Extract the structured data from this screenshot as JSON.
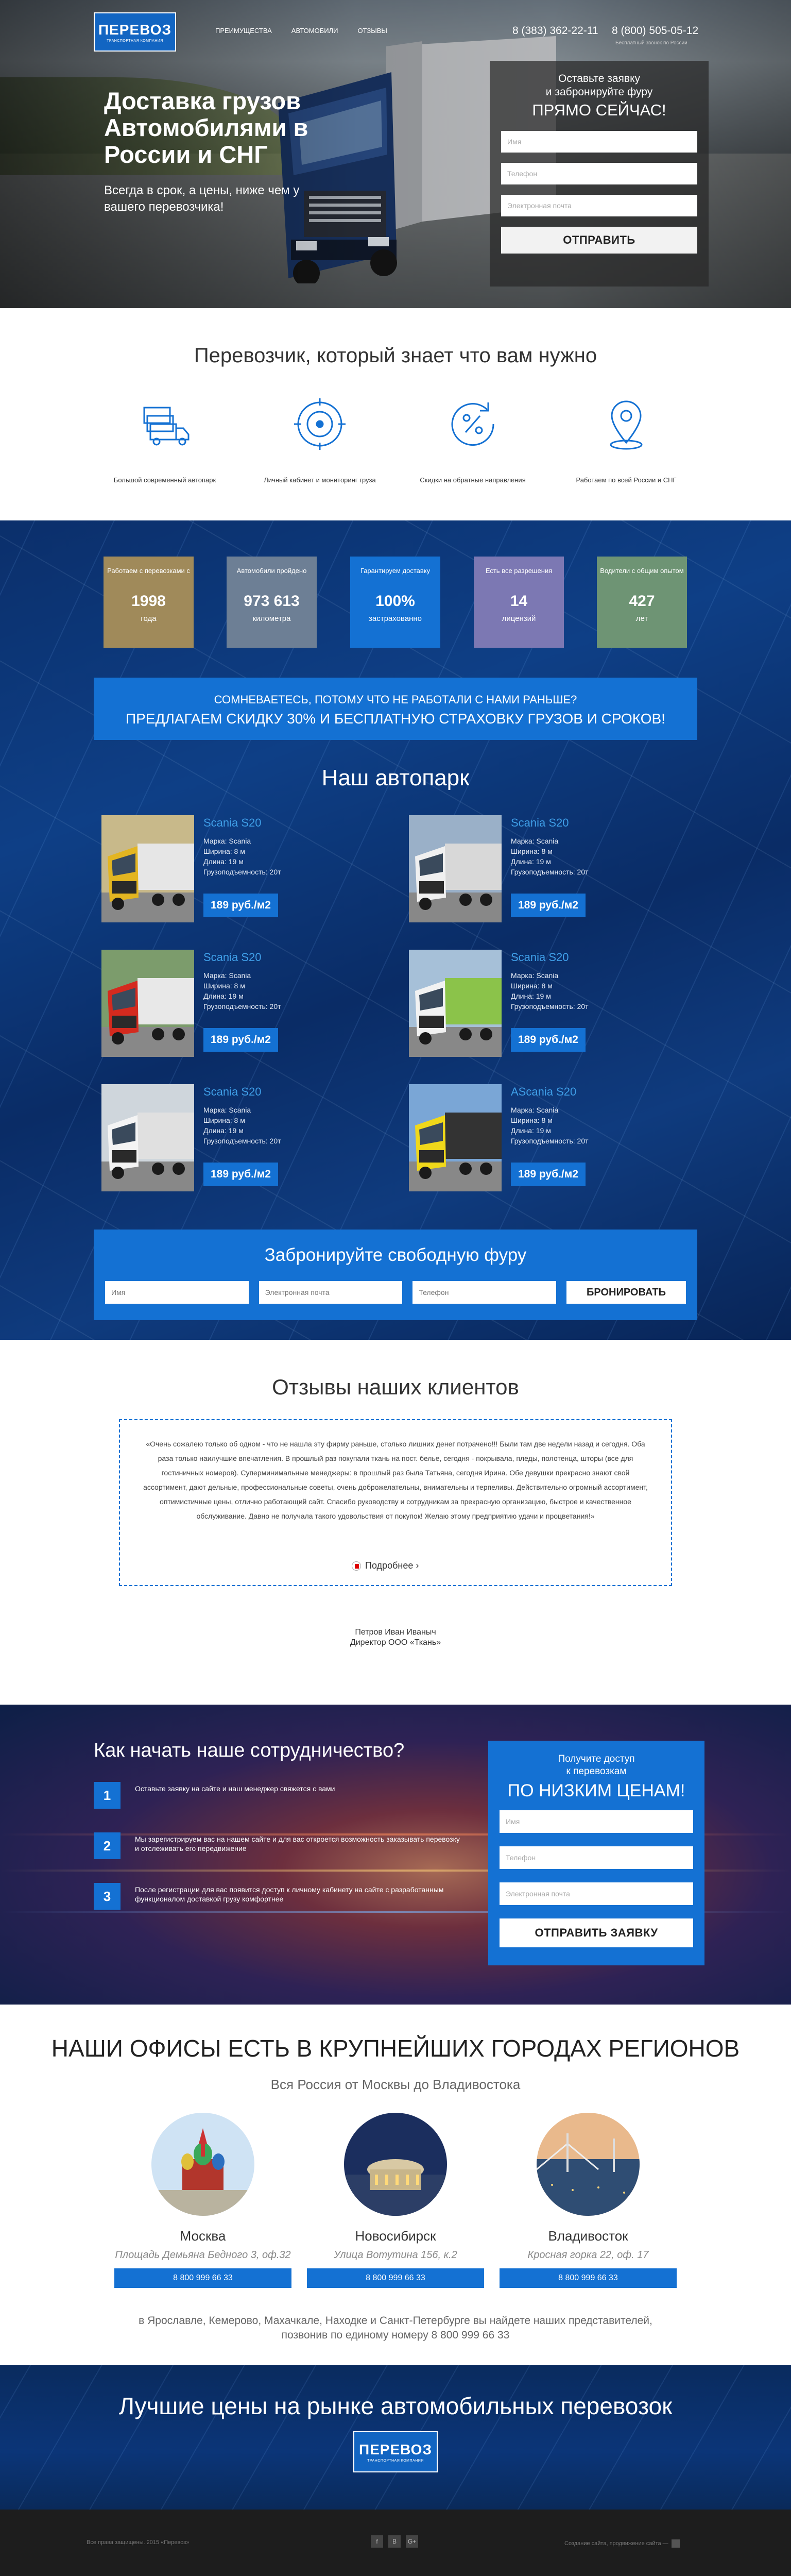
{
  "header": {
    "logo_main": "ПЕРЕВОЗ",
    "logo_sub": "ТРАНСПОРТНАЯ КОМПАНИЯ",
    "nav": [
      "ПРЕИМУЩЕСТВА",
      "АВТОМОБИЛИ",
      "ОТЗЫВЫ"
    ],
    "phone1": "8 (383) 362-22-11",
    "phone2": "8 (800) 505-05-12",
    "phone_note": "Бесплатный звонок по России"
  },
  "hero": {
    "title": "Доставка грузов Автомобилями в России и СНГ",
    "subtitle": "Всегда в срок, а цены, ниже чем у вашего перевозчика!",
    "form_line1": "Оставьте заявку",
    "form_line2": "и забронируйте фуру",
    "form_line3": "ПРЯМО СЕЙЧАС!",
    "ph_name": "Имя",
    "ph_phone": "Телефон",
    "ph_email": "Электронная почта",
    "submit": "ОТПРАВИТЬ"
  },
  "features": {
    "title": "Перевозчик, который знает что вам нужно",
    "items": [
      {
        "label": "Большой современный автопарк",
        "icon": "trucks-icon"
      },
      {
        "label": "Личный кабинет и мониторинг груза",
        "icon": "monitoring-icon"
      },
      {
        "label": "Скидки на обратные направления",
        "icon": "discount-icon"
      },
      {
        "label": "Работаем по всей России и СНГ",
        "icon": "location-icon"
      }
    ]
  },
  "stats": [
    {
      "top": "Работаем с перевозками с",
      "num": "1998",
      "bottom": "года",
      "color": "#a08a5a"
    },
    {
      "top": "Автомобили пройдено",
      "num": "973 613",
      "bottom": "километра",
      "color": "#6d7f95"
    },
    {
      "top": "Гарантируем доставку",
      "num": "100%",
      "bottom": "застрахованно",
      "color": "#1471d3"
    },
    {
      "top": "Есть все разрешения",
      "num": "14",
      "bottom": "лицензий",
      "color": "#7c78b3"
    },
    {
      "top": "Водители с общим опытом",
      "num": "427",
      "bottom": "лет",
      "color": "#6e9474"
    }
  ],
  "banner": {
    "line1": "СОМНЕВАЕТЕСЬ, ПОТОМУ ЧТО НЕ РАБОТАЛИ С НАМИ РАНЬШЕ?",
    "line2": "ПРЕДЛАГАЕМ СКИДКУ 30% И БЕСПЛАТНУЮ СТРАХОВКУ ГРУЗОВ И СРОКОВ!"
  },
  "fleet": {
    "title": "Наш автопарк",
    "cards": [
      {
        "name": "Scania S20",
        "brand": "Марка: Scania",
        "width": "Ширина: 8 м",
        "length": "Длина: 19 м",
        "load": "Грузоподъемность: 20т",
        "price": "189 руб./м2",
        "cab": "#e3b521",
        "trailer": "#e6e6e6",
        "bg": "#c8b98a"
      },
      {
        "name": "Scania S20",
        "brand": "Марка: Scania",
        "width": "Ширина: 8 м",
        "length": "Длина: 19 м",
        "load": "Грузоподъемность: 20т",
        "price": "189 руб./м2",
        "cab": "#f0f0f0",
        "trailer": "#d8d8d8",
        "bg": "#9ab0c8"
      },
      {
        "name": "Scania S20",
        "brand": "Марка: Scania",
        "width": "Ширина: 8 м",
        "length": "Длина: 19 м",
        "load": "Грузоподъемность: 20т",
        "price": "189 руб./м2",
        "cab": "#d42a1e",
        "trailer": "#e8e8e8",
        "bg": "#7c9c6c"
      },
      {
        "name": "Scania S20",
        "brand": "Марка: Scania",
        "width": "Ширина: 8 м",
        "length": "Длина: 19 м",
        "load": "Грузоподъемность: 20т",
        "price": "189 руб./м2",
        "cab": "#f2f2f2",
        "trailer": "#8bc34a",
        "bg": "#a6c0d8"
      },
      {
        "name": "Scania S20",
        "brand": "Марка: Scania",
        "width": "Ширина: 8 м",
        "length": "Длина: 19 м",
        "load": "Грузоподъемность: 20т",
        "price": "189 руб./м2",
        "cab": "#f4f4f4",
        "trailer": "#e0e0e0",
        "bg": "#cfd6dc"
      },
      {
        "name": "AScania S20",
        "brand": "Марка: Scania",
        "width": "Ширина: 8 м",
        "length": "Длина: 19 м",
        "load": "Грузоподъемность: 20т",
        "price": "189 руб./м2",
        "cab": "#f0d81a",
        "trailer": "#333333",
        "bg": "#7aa6d6"
      }
    ]
  },
  "booking": {
    "title": "Забронируйте свободную фуру",
    "ph_name": "Имя",
    "ph_email": "Электронная почта",
    "ph_phone": "Телефон",
    "button": "БРОНИРОВАТЬ"
  },
  "reviews": {
    "title": "Отзывы наших клиентов",
    "text": "«Очень сожалею только об одном - что не нашла эту фирму раньше, столько лишних денег потрачено!!! Были там две недели назад и сегодня. Оба раза только наилучшие впечатления. В прошлый раз покупали ткань на пост. белье, сегодня - покрывала, пледы, полотенца, шторы (все для гостиничных номеров). Суперминимальные менеджеры: в прошлый раз была Татьяна, сегодня Ирина. Обе девушки прекрасно знают свой ассортимент, дают дельные, профессиональные советы, очень доброжелательны, внимательны и терпеливы. Действительно огромный ассортимент, оптимистичные цены, отлично работающий сайт. Спасибо руководству и сотрудникам за прекрасную организацию, быстрое и качественное обслуживание. Давно не получала такого удовольствия от покупок! Желаю этому предприятию удачи и процветания!»",
    "more": "Подробнее ›",
    "author_name": "Петров Иван Иваныч",
    "author_role": "Директор ООО «Ткань»"
  },
  "start": {
    "title": "Как начать наше сотрудничество?",
    "steps": [
      {
        "num": "1",
        "text": "Оставьте заявку на сайте и наш менеджер свяжется с вами"
      },
      {
        "num": "2",
        "text": "Мы зарегистрируем вас на нашем сайте и для вас откроется возможность заказывать перевозку и отслеживать его передвижение"
      },
      {
        "num": "3",
        "text": "После регистрации для вас появится доступ к личному кабинету на сайте с разработанным функционалом доставкой грузу комфортнее"
      }
    ],
    "form_line1": "Получите доступ",
    "form_line2": "к перевозкам",
    "form_line3": "ПО НИЗКИМ ЦЕНАМ!",
    "ph_name": "Имя",
    "ph_phone": "Телефон",
    "ph_email": "Электронная почта",
    "submit": "ОТПРАВИТЬ ЗАЯВКУ"
  },
  "offices": {
    "title": "НАШИ ОФИСЫ ЕСТЬ В КРУПНЕЙШИХ ГОРОДАХ РЕГИОНОВ",
    "subtitle": "Вся Россия от Москвы до Владивостока",
    "items": [
      {
        "city": "Москва",
        "address": "Площадь Демьяна Бедного 3, оф.32",
        "phone": "8 800 999 66 33"
      },
      {
        "city": "Новосибирск",
        "address": "Улица Вотутина 156, к.2",
        "phone": "8 800 999 66 33"
      },
      {
        "city": "Владивосток",
        "address": "Кросная горка 22, оф. 17",
        "phone": "8 800 999 66 33"
      }
    ],
    "footer_line1": "в Ярославле, Кемерово, Махачкале, Находке и Санкт-Петербурге вы найдете наших представителей,",
    "footer_line2": "позвонив по единому номеру 8 800 999 66 33"
  },
  "cta": {
    "title": "Лучшие цены на рынке автомобильных перевозок",
    "logo_main": "ПЕРЕВОЗ",
    "logo_sub": "ТРАНСПОРТНАЯ КОМПАНИЯ"
  },
  "footer": {
    "copyright": "Все права защищены. 2015 «Перевоз»",
    "social": [
      "f",
      "В",
      "G+"
    ],
    "dev": "Создание сайта, продвижение сайта —"
  },
  "colors": {
    "accent": "#1471d3",
    "dark_blue": "#0b2f6b",
    "light_blue_text": "#3f9fe8"
  }
}
